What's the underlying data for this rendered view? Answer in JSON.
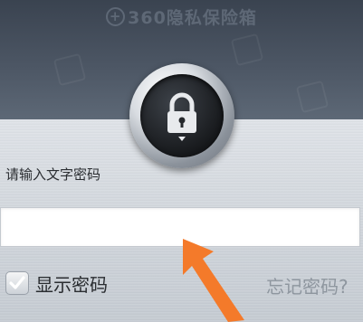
{
  "header": {
    "app_title": "360隐私保险箱",
    "logo_icon": "plus-circle-icon",
    "logo_glyph": "+"
  },
  "lock": {
    "icon": "padlock-icon"
  },
  "form": {
    "prompt_label": "请输入文字密码",
    "password_value": "",
    "show_password_label": "显示密码",
    "show_password_checked": true,
    "forgot_password_link": "忘记密码?"
  },
  "overlay": {
    "pointer": "arrow-pointer-icon",
    "pointer_color": "#f47a2a"
  }
}
